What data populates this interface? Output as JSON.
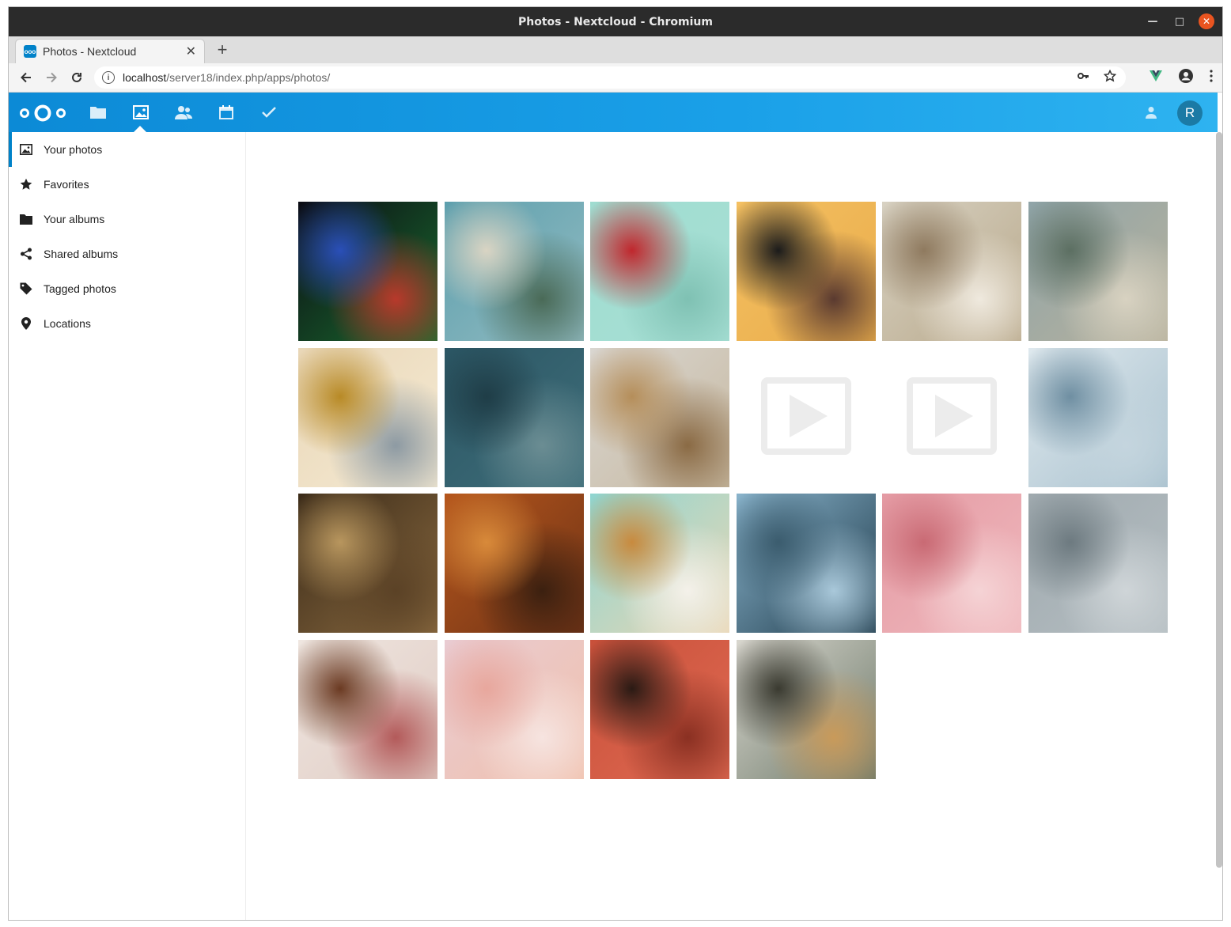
{
  "window": {
    "title": "Photos - Nextcloud - Chromium"
  },
  "tab": {
    "title": "Photos - Nextcloud",
    "favicon_text": "ooo"
  },
  "address_bar": {
    "host": "localhost",
    "path": "/server18/index.php/apps/photos/"
  },
  "header": {
    "avatar_initial": "R",
    "accent": "#0082c9"
  },
  "sidebar": {
    "items": [
      {
        "label": "Your photos",
        "icon": "image-icon",
        "active": true
      },
      {
        "label": "Favorites",
        "icon": "star-icon",
        "active": false
      },
      {
        "label": "Your albums",
        "icon": "folder-icon",
        "active": false
      },
      {
        "label": "Shared albums",
        "icon": "share-icon",
        "active": false
      },
      {
        "label": "Tagged photos",
        "icon": "tag-icon",
        "active": false
      },
      {
        "label": "Locations",
        "icon": "location-icon",
        "active": false
      }
    ]
  },
  "photos": [
    {
      "kind": "image",
      "subject": "bokeh-lights",
      "colors": [
        "#0b0b14",
        "#1a6d2f",
        "#2a4fb8",
        "#b8392b"
      ]
    },
    {
      "kind": "image",
      "subject": "snowy-tree",
      "colors": [
        "#5d9fad",
        "#93bcc2",
        "#d9d4c3",
        "#4a6a57"
      ]
    },
    {
      "kind": "image",
      "subject": "christmas-ornaments",
      "colors": [
        "#9fdcd0",
        "#a8e0d5",
        "#c0272d",
        "#7fc1b3"
      ]
    },
    {
      "kind": "image",
      "subject": "black-cat",
      "colors": [
        "#f4c062",
        "#e9ac4a",
        "#1b1b1b",
        "#5a3a30"
      ]
    },
    {
      "kind": "image",
      "subject": "glass-dome",
      "colors": [
        "#d8d2c3",
        "#b8a88a",
        "#8f7a5f",
        "#efe9de"
      ]
    },
    {
      "kind": "image",
      "subject": "tiled-courtyard",
      "colors": [
        "#8fa4a8",
        "#b8b29d",
        "#5c6f62",
        "#d8d2c1"
      ]
    },
    {
      "kind": "image",
      "subject": "sunset-lake",
      "colors": [
        "#e9d7b8",
        "#f5ead3",
        "#b88a26",
        "#8d9aa3"
      ]
    },
    {
      "kind": "image",
      "subject": "old-door",
      "colors": [
        "#2b5664",
        "#3f6e7a",
        "#1f3d47",
        "#6b8d93"
      ]
    },
    {
      "kind": "image",
      "subject": "white-house",
      "colors": [
        "#d9d6d1",
        "#c7b9a1",
        "#b58e5a",
        "#8a6a44"
      ]
    },
    {
      "kind": "video"
    },
    {
      "kind": "video"
    },
    {
      "kind": "image",
      "subject": "white-arches",
      "colors": [
        "#dfe9ee",
        "#a9c1ce",
        "#6f8fa2",
        "#c4d5de"
      ]
    },
    {
      "kind": "image",
      "subject": "wooden-curve",
      "colors": [
        "#3a2a18",
        "#8a6a40",
        "#b8965e",
        "#5b4226"
      ]
    },
    {
      "kind": "image",
      "subject": "autumn-leaves",
      "colors": [
        "#b5561c",
        "#6e3216",
        "#d88a3a",
        "#3b2010"
      ]
    },
    {
      "kind": "image",
      "subject": "breakfast-menu",
      "colors": [
        "#8fd5d0",
        "#e9d6b4",
        "#c88a3e",
        "#f4f1ea"
      ]
    },
    {
      "kind": "image",
      "subject": "skyscraper-plane",
      "colors": [
        "#8ab4cc",
        "#1e3a4a",
        "#3b5c6e",
        "#a9c8da"
      ]
    },
    {
      "kind": "image",
      "subject": "pink-stairs",
      "colors": [
        "#e49aa3",
        "#f0b9be",
        "#c96a74",
        "#f5d3d5"
      ]
    },
    {
      "kind": "image",
      "subject": "stadium-seats",
      "colors": [
        "#9fa9ae",
        "#b6bfc3",
        "#6d7a80",
        "#cfd5d8"
      ]
    },
    {
      "kind": "image",
      "subject": "cake-table",
      "colors": [
        "#efe6e0",
        "#e0ccc4",
        "#6b3a22",
        "#b35a5a"
      ]
    },
    {
      "kind": "image",
      "subject": "pink-silos",
      "colors": [
        "#e9ccd3",
        "#f0c0ac",
        "#e8a79d",
        "#f6e4e0"
      ]
    },
    {
      "kind": "image",
      "subject": "red-building-person",
      "colors": [
        "#c8503a",
        "#e06a52",
        "#2a1a14",
        "#8a3022"
      ]
    },
    {
      "kind": "image",
      "subject": "coats-hanging",
      "colors": [
        "#d9d7cf",
        "#6e7a6a",
        "#3a3a30",
        "#c99a5a"
      ]
    }
  ]
}
